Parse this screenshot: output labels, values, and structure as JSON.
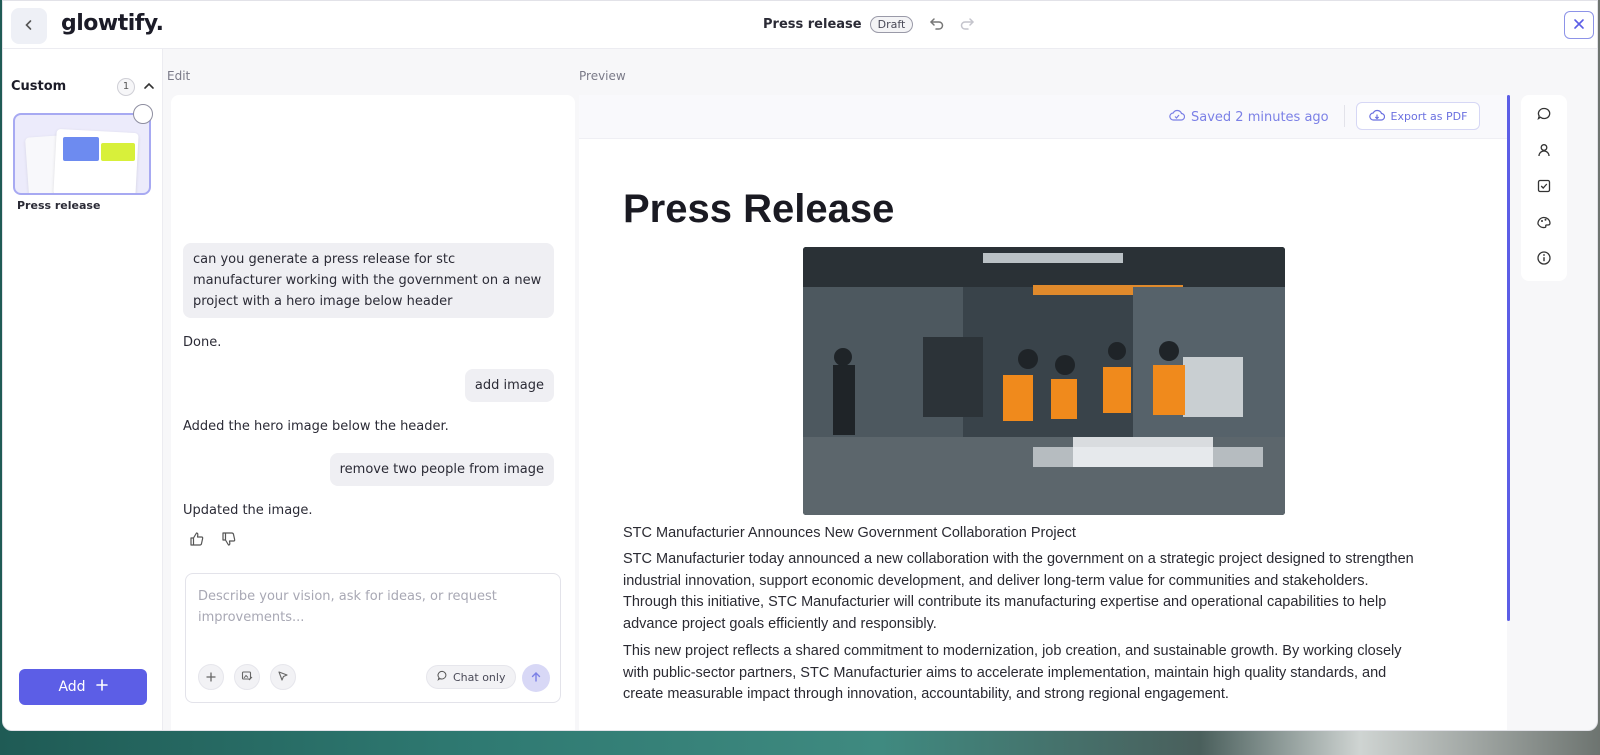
{
  "app": {
    "logo": "glowtify.",
    "doc_title": "Press release",
    "status_badge": "Draft"
  },
  "sidebar": {
    "section_title": "Custom",
    "count": "1",
    "templates": [
      {
        "label": "Press release",
        "selected": false
      }
    ],
    "add_label": "Add"
  },
  "edit": {
    "section_label": "Edit",
    "messages": [
      {
        "role": "user",
        "text": "can you generate a press release for stc manufacturer working with the government on a new project with a hero image below header"
      },
      {
        "role": "assistant",
        "text": "Done."
      },
      {
        "role": "user",
        "text": "add image"
      },
      {
        "role": "assistant",
        "text": "Added the hero image below the header."
      },
      {
        "role": "user",
        "text": "remove two people from image"
      },
      {
        "role": "assistant",
        "text": "Updated the image."
      }
    ],
    "composer": {
      "placeholder": "Describe your vision, ask for ideas, or request improvements...",
      "chat_only_label": "Chat only"
    }
  },
  "preview": {
    "section_label": "Preview",
    "saved_text": "Saved 2 minutes ago",
    "export_label": "Export as PDF",
    "document": {
      "title": "Press Release",
      "subtitle": "STC Manufacturier Announces New Government Collaboration Project",
      "paragraphs": [
        "STC Manufacturier today announced a new collaboration with the government on a strategic project designed to strengthen industrial innovation, support economic development, and deliver long-term value for communities and stakeholders. Through this initiative, STC Manufacturier will contribute its manufacturing expertise and operational capabilities to help advance project goals efficiently and responsibly.",
        "This new project reflects a shared commitment to modernization, job creation, and sustainable growth. By working closely with public-sector partners, STC Manufacturier aims to accelerate implementation, maintain high quality standards, and create measurable impact through innovation, accountability, and strong regional engagement."
      ]
    }
  },
  "colors": {
    "accent": "#5c5ee6",
    "accent_light": "#7b80e6",
    "text": "#2b2b36"
  },
  "icons": {
    "back": "chevron-left-icon",
    "undo": "undo-icon",
    "redo": "redo-icon",
    "close": "close-icon",
    "rail": [
      "comment-icon",
      "user-icon",
      "checkbox-icon",
      "palette-icon",
      "info-icon"
    ]
  }
}
